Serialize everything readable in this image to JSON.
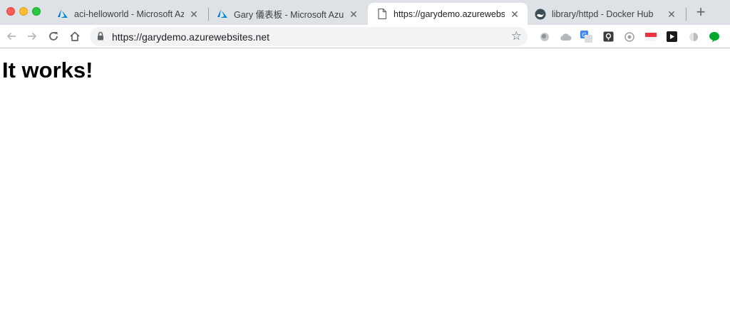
{
  "browser": {
    "tabs": [
      {
        "title": "aci-helloworld - Microsoft Azure",
        "icon": "azure-icon",
        "active": false
      },
      {
        "title": "Gary 儀表板 - Microsoft Azure",
        "icon": "azure-icon",
        "active": false
      },
      {
        "title": "https://garydemo.azurewebsites.net",
        "icon": "page-icon",
        "active": true
      },
      {
        "title": "library/httpd - Docker Hub",
        "icon": "docker-hub-icon",
        "active": false
      }
    ],
    "close_glyph": "✕",
    "new_tab_glyph": "+",
    "address_bar": {
      "url": "https://garydemo.azurewebsites.net",
      "bookmark_glyph": "☆"
    },
    "extensions": [
      "gray-circle-icon",
      "cloud-icon",
      "translate-icon",
      "pocket-icon",
      "record-icon",
      "flag-icon",
      "play-icon",
      "toggle-icon",
      "evernote-icon"
    ],
    "colors": {
      "tabstrip": "#dee1e6",
      "azure": "#0078d4",
      "evernote": "#00a82d"
    }
  },
  "page": {
    "heading": "It works!"
  }
}
